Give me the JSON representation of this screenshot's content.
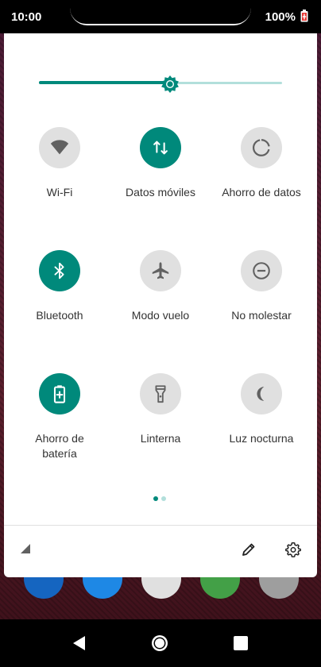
{
  "status_bar": {
    "time": "10:00",
    "battery": "100%"
  },
  "brightness": {
    "level_fraction": 0.54
  },
  "tiles": [
    {
      "label": "Wi-Fi",
      "active": false,
      "icon": "wifi-icon"
    },
    {
      "label": "Datos móviles",
      "active": true,
      "icon": "mobile-data-icon"
    },
    {
      "label": "Ahorro de datos",
      "active": false,
      "icon": "data-saver-icon"
    },
    {
      "label": "Bluetooth",
      "active": true,
      "icon": "bluetooth-icon"
    },
    {
      "label": "Modo vuelo",
      "active": false,
      "icon": "airplane-icon"
    },
    {
      "label": "No molestar",
      "active": false,
      "icon": "do-not-disturb-icon"
    },
    {
      "label": "Ahorro de\nbatería",
      "active": true,
      "icon": "battery-saver-icon"
    },
    {
      "label": "Linterna",
      "active": false,
      "icon": "flashlight-icon"
    },
    {
      "label": "Luz nocturna",
      "active": false,
      "icon": "night-light-icon"
    }
  ],
  "pager": {
    "pages": 2,
    "current": 0
  },
  "footer": {
    "left_icon": "signal-icon",
    "edit_icon": "edit-pencil-icon",
    "settings_icon": "settings-gear-icon"
  },
  "navigation": [
    "back-icon",
    "home-icon",
    "recents-icon"
  ],
  "colors": {
    "accent": "#00897b",
    "inactive": "#e0e0e0",
    "inactive_icon": "#616161",
    "slider_track": "#b2dfdb"
  }
}
